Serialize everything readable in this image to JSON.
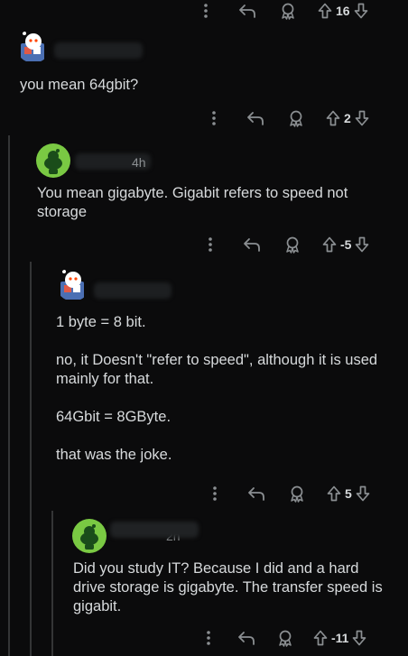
{
  "colors": {
    "background": "#0b0b0c",
    "text": "#d7dadc",
    "muted": "#8b8f92",
    "thread_line": "#343536",
    "avatar_green": "#7ac943"
  },
  "icons": [
    "more-icon",
    "reply-icon",
    "award-icon",
    "upvote-icon",
    "downvote-icon"
  ],
  "comments": [
    {
      "score": "16"
    },
    {
      "body": [
        "you mean 64gbit?"
      ],
      "score": "2"
    },
    {
      "time": "4h",
      "body": [
        "You mean gigabyte. Gigabit refers to speed not storage"
      ],
      "score": "-5"
    },
    {
      "body": [
        "1 byte = 8 bit.",
        "no, it Doesn't \"refer to speed\", although it is used mainly for that.",
        "64Gbit = 8GByte.",
        "that was the joke."
      ],
      "score": "5"
    },
    {
      "time": "2h",
      "body": [
        "Did you study IT? Because I did and a hard drive storage is gigabyte. The transfer speed is gigabit."
      ],
      "score": "-11"
    }
  ]
}
